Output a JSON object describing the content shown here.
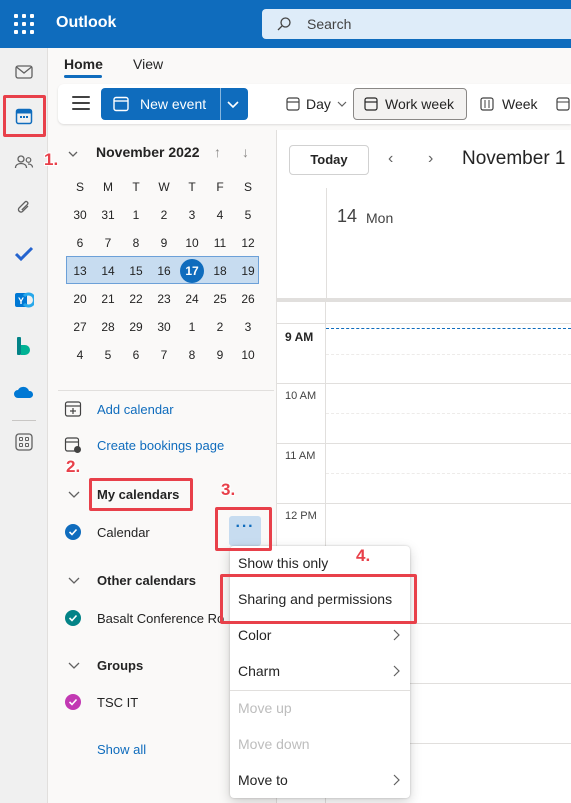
{
  "app": {
    "title": "Outlook"
  },
  "search": {
    "placeholder": "Search"
  },
  "ribbon": {
    "tabs": [
      {
        "label": "Home"
      },
      {
        "label": "View"
      }
    ],
    "new_event": "New event",
    "views": [
      {
        "label": "Day"
      },
      {
        "label": "Work week"
      },
      {
        "label": "Week"
      }
    ]
  },
  "mini_calendar": {
    "month_label": "November 2022",
    "weekdays": [
      "S",
      "M",
      "T",
      "W",
      "T",
      "F",
      "S"
    ],
    "weeks": [
      [
        "30",
        "31",
        "1",
        "2",
        "3",
        "4",
        "5"
      ],
      [
        "6",
        "7",
        "8",
        "9",
        "10",
        "11",
        "12"
      ],
      [
        "13",
        "14",
        "15",
        "16",
        "17",
        "18",
        "19"
      ],
      [
        "20",
        "21",
        "22",
        "23",
        "24",
        "25",
        "26"
      ],
      [
        "27",
        "28",
        "29",
        "30",
        "1",
        "2",
        "3"
      ],
      [
        "4",
        "5",
        "6",
        "7",
        "8",
        "9",
        "10"
      ]
    ],
    "today": "17"
  },
  "left_links": {
    "add_calendar": "Add calendar",
    "create_bookings": "Create bookings page"
  },
  "my_calendars": {
    "title": "My calendars",
    "items": [
      {
        "name": "Calendar",
        "color": "#0f6cbd"
      }
    ]
  },
  "other_calendars": {
    "title": "Other calendars",
    "items": [
      {
        "name": "Basalt Conference Ro",
        "color": "#038387"
      }
    ]
  },
  "groups": {
    "title": "Groups",
    "items": [
      {
        "name": "TSC IT",
        "color": "#c239b3"
      }
    ]
  },
  "show_all": "Show all",
  "more_button": "···",
  "main": {
    "today_button": "Today",
    "range_title": "November 1",
    "day_number": "14",
    "day_name": "Mon",
    "hours": [
      "9 AM",
      "10 AM",
      "11 AM",
      "12 PM"
    ]
  },
  "context_menu": {
    "items": [
      {
        "label": "Show this only"
      },
      {
        "label": "Sharing and permissions"
      },
      {
        "label": "Color"
      },
      {
        "label": "Charm"
      },
      {
        "label": "Move up"
      },
      {
        "label": "Move down"
      },
      {
        "label": "Move to"
      }
    ]
  },
  "annotations": {
    "step1": "1.",
    "step2": "2.",
    "step3": "3.",
    "step4": "4."
  },
  "colors": {
    "accent": "#0f6cbd",
    "annotation": "#e8404a"
  }
}
